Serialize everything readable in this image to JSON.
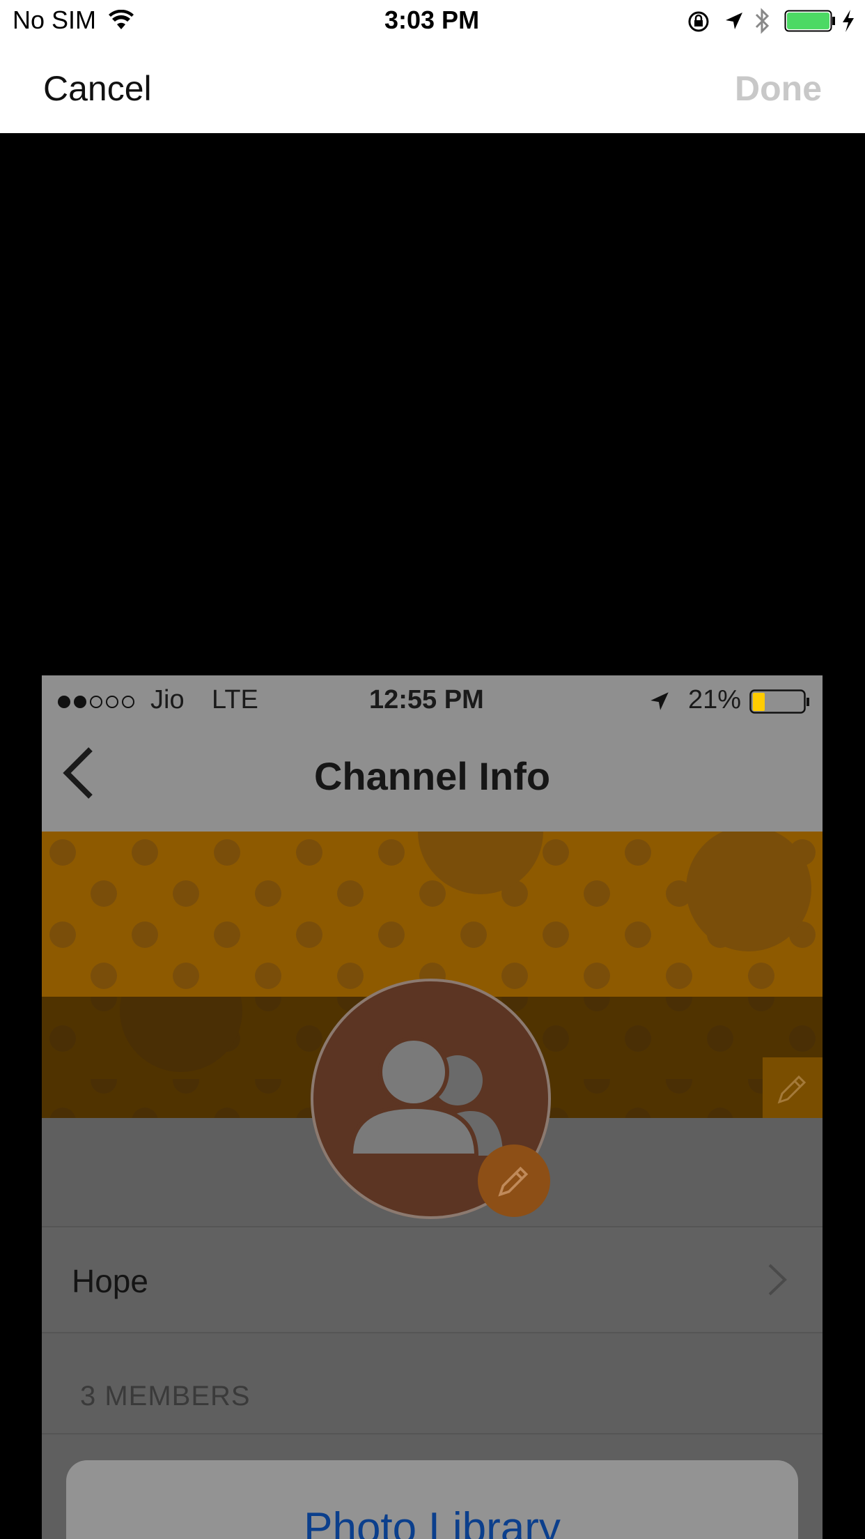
{
  "status_bar": {
    "carrier": "No SIM",
    "time": "3:03 PM",
    "battery_color": "#4cd964"
  },
  "nav": {
    "cancel_label": "Cancel",
    "done_label": "Done"
  },
  "photo": {
    "status": {
      "carrier": "Jio",
      "network": "LTE",
      "time": "12:55 PM",
      "battery_pct": "21%",
      "battery_fill_color": "#ffcc00"
    },
    "title": "Channel Info",
    "banner_color": "#e08c00",
    "avatar_color": "#c1552e",
    "channel_name": "Hope",
    "members_header": "3 MEMBERS",
    "sheet_option": "Photo Library"
  }
}
